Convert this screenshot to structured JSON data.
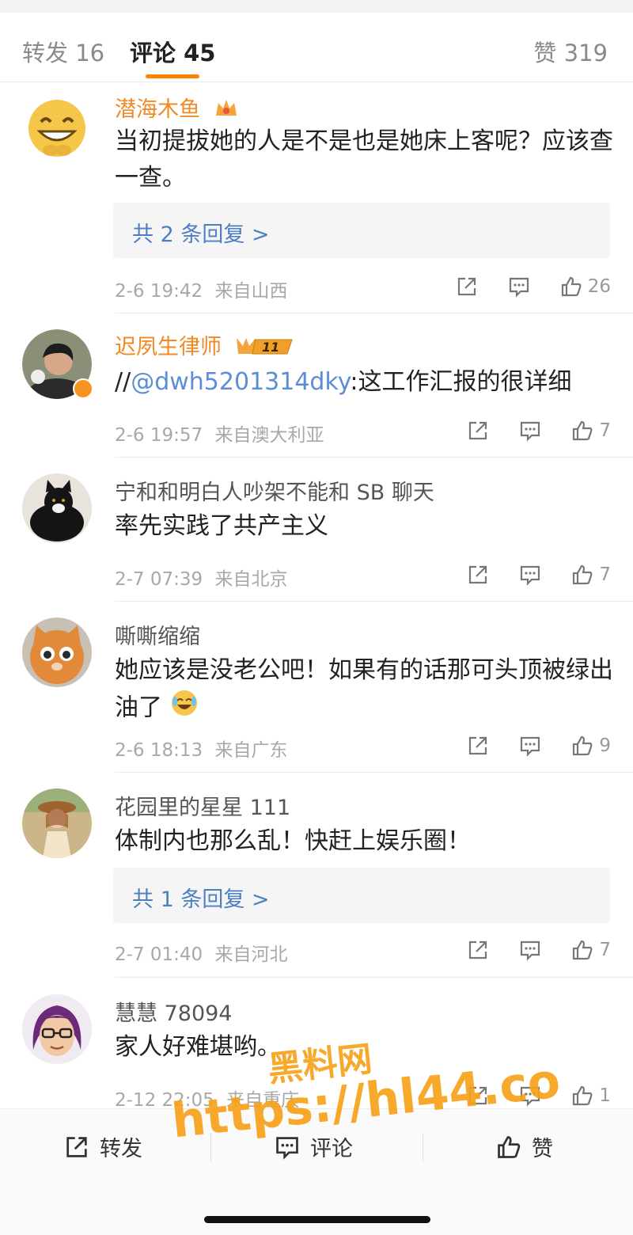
{
  "tabs": {
    "reposts": "转发 16",
    "comments": "评论 45",
    "likes": "赞 319"
  },
  "comments": [
    {
      "name": "潜海木鱼",
      "text": "当初提拔她的人是不是也是她床上客呢？应该查一查。",
      "reply": "共 2 条回复 >",
      "time": "2-6 19:42",
      "location": "来自山西",
      "likes": "26"
    },
    {
      "name": "迟夙生律师",
      "badge_text": "11",
      "text_prefix": "//",
      "mention": "@dwh5201314dky",
      "text_rest": ":这工作汇报的很详细",
      "time": "2-6 19:57",
      "location": "来自澳大利亚",
      "likes": "7"
    },
    {
      "name": "宁和和明白人吵架不能和 SB 聊天",
      "text": "率先实践了共产主义",
      "time": "2-7 07:39",
      "location": "来自北京",
      "likes": "7"
    },
    {
      "name": "嘶嘶缩缩",
      "text": "她应该是没老公吧！如果有的话那可头顶被绿出油了",
      "time": "2-6 18:13",
      "location": "来自广东",
      "likes": "9"
    },
    {
      "name": "花园里的星星 111",
      "text": "体制内也那么乱！快赶上娱乐圈！",
      "reply": "共 1 条回复 >",
      "time": "2-7 01:40",
      "location": "来自河北",
      "likes": "7"
    },
    {
      "name": "慧慧 78094",
      "text": "家人好难堪哟。",
      "time": "2-12 22:05",
      "location": "来自重庆",
      "likes": "1"
    }
  ],
  "bottom_bar": {
    "repost": "转发",
    "comment": "评论",
    "like": "赞"
  },
  "watermark": {
    "line1": "黑料网",
    "line2": "https://hl44.co"
  },
  "colors": {
    "accent": "#ff8200",
    "vip_name": "#f08a24",
    "link": "#4d7fc2"
  },
  "icons": [
    "share-icon",
    "comment-icon",
    "like-icon",
    "crown-icon",
    "vip-badge-icon",
    "verified-icon",
    "laughing-crying-emoji-icon"
  ]
}
